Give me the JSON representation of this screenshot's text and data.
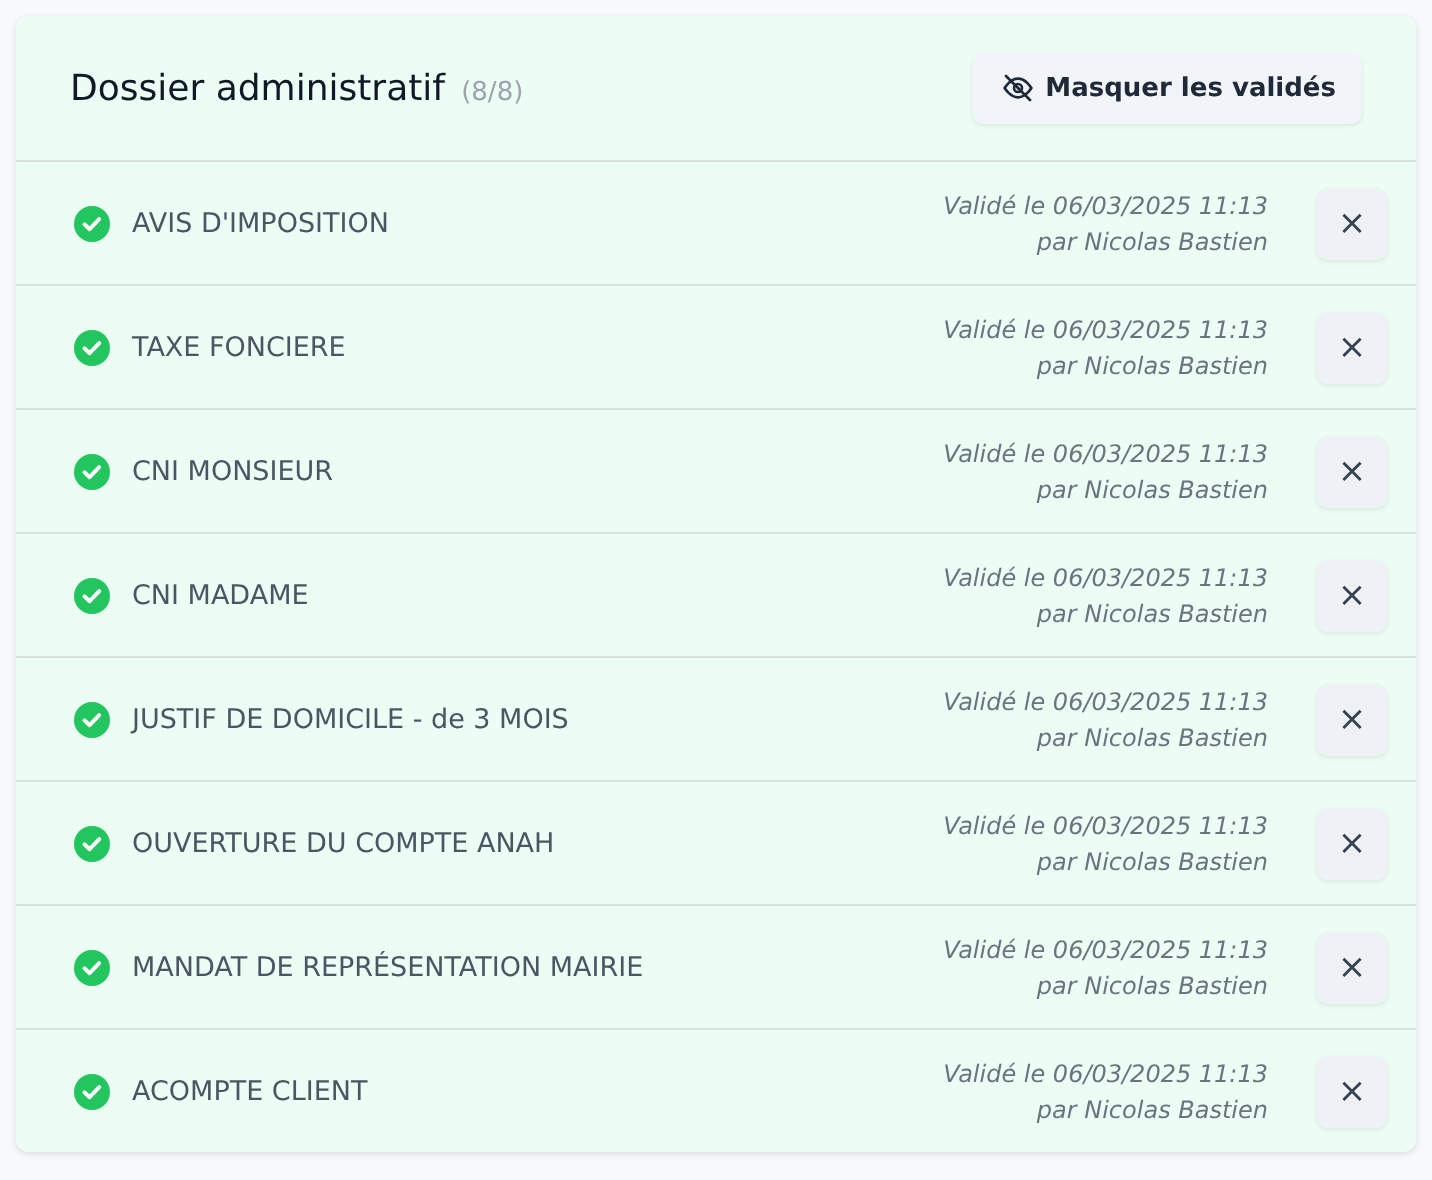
{
  "header": {
    "title": "Dossier administratif",
    "count": "(8/8)",
    "toggle_button": {
      "label": "Masquer les validés"
    }
  },
  "documents": [
    {
      "label": "AVIS D'IMPOSITION",
      "validated": true,
      "validated_line": "Validé le 06/03/2025 11:13",
      "validated_by": "par Nicolas Bastien",
      "remove_button": "×"
    },
    {
      "label": "TAXE FONCIERE",
      "validated": true,
      "validated_line": "Validé le 06/03/2025 11:13",
      "validated_by": "par Nicolas Bastien",
      "remove_button": "×"
    },
    {
      "label": "CNI MONSIEUR",
      "validated": true,
      "validated_line": "Validé le 06/03/2025 11:13",
      "validated_by": "par Nicolas Bastien",
      "remove_button": "×"
    },
    {
      "label": "CNI MADAME",
      "validated": true,
      "validated_line": "Validé le 06/03/2025 11:13",
      "validated_by": "par Nicolas Bastien",
      "remove_button": "×"
    },
    {
      "label": "JUSTIF DE DOMICILE - de 3 MOIS",
      "validated": true,
      "validated_line": "Validé le 06/03/2025 11:13",
      "validated_by": "par Nicolas Bastien",
      "remove_button": "×"
    },
    {
      "label": "OUVERTURE DU COMPTE ANAH",
      "validated": true,
      "validated_line": "Validé le 06/03/2025 11:13",
      "validated_by": "par Nicolas Bastien",
      "remove_button": "×"
    },
    {
      "label": "MANDAT DE REPRÉSENTATION MAIRIE",
      "validated": true,
      "validated_line": "Validé le 06/03/2025 11:13",
      "validated_by": "par Nicolas Bastien",
      "remove_button": "×"
    },
    {
      "label": "ACOMPTE CLIENT",
      "validated": true,
      "validated_line": "Validé le 06/03/2025 11:13",
      "validated_by": "par Nicolas Bastien",
      "remove_button": "×"
    }
  ]
}
